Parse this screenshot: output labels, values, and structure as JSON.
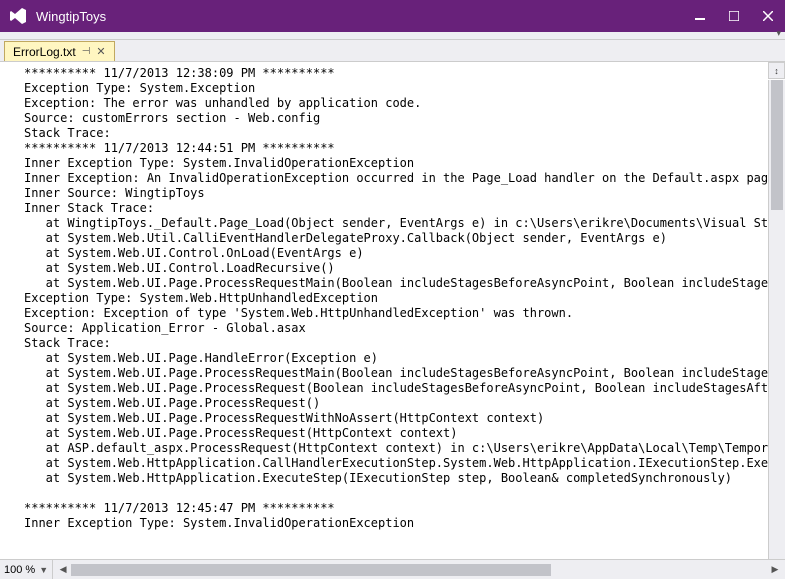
{
  "window": {
    "title": "WingtipToys"
  },
  "tab": {
    "label": "ErrorLog.txt"
  },
  "zoom": {
    "value": "100 %"
  },
  "log": {
    "lines": [
      "********** 11/7/2013 12:38:09 PM **********",
      "Exception Type: System.Exception",
      "Exception: The error was unhandled by application code.",
      "Source: customErrors section - Web.config",
      "Stack Trace: ",
      "********** 11/7/2013 12:44:51 PM **********",
      "Inner Exception Type: System.InvalidOperationException",
      "Inner Exception: An InvalidOperationException occurred in the Page_Load handler on the Default.aspx page.",
      "Inner Source: WingtipToys",
      "Inner Stack Trace: ",
      "   at WingtipToys._Default.Page_Load(Object sender, EventArgs e) in c:\\Users\\erikre\\Documents\\Visual St",
      "   at System.Web.Util.CalliEventHandlerDelegateProxy.Callback(Object sender, EventArgs e)",
      "   at System.Web.UI.Control.OnLoad(EventArgs e)",
      "   at System.Web.UI.Control.LoadRecursive()",
      "   at System.Web.UI.Page.ProcessRequestMain(Boolean includeStagesBeforeAsyncPoint, Boolean includeStage",
      "Exception Type: System.Web.HttpUnhandledException",
      "Exception: Exception of type 'System.Web.HttpUnhandledException' was thrown.",
      "Source: Application_Error - Global.asax",
      "Stack Trace: ",
      "   at System.Web.UI.Page.HandleError(Exception e)",
      "   at System.Web.UI.Page.ProcessRequestMain(Boolean includeStagesBeforeAsyncPoint, Boolean includeStage",
      "   at System.Web.UI.Page.ProcessRequest(Boolean includeStagesBeforeAsyncPoint, Boolean includeStagesAft",
      "   at System.Web.UI.Page.ProcessRequest()",
      "   at System.Web.UI.Page.ProcessRequestWithNoAssert(HttpContext context)",
      "   at System.Web.UI.Page.ProcessRequest(HttpContext context)",
      "   at ASP.default_aspx.ProcessRequest(HttpContext context) in c:\\Users\\erikre\\AppData\\Local\\Temp\\Tempor",
      "   at System.Web.HttpApplication.CallHandlerExecutionStep.System.Web.HttpApplication.IExecutionStep.Exe",
      "   at System.Web.HttpApplication.ExecuteStep(IExecutionStep step, Boolean& completedSynchronously)",
      "",
      "********** 11/7/2013 12:45:47 PM **********",
      "Inner Exception Type: System.InvalidOperationException"
    ]
  }
}
